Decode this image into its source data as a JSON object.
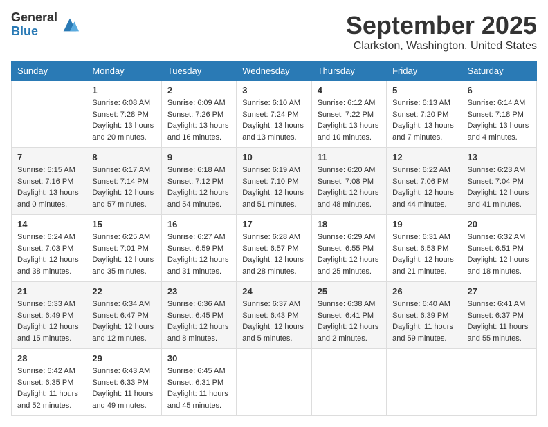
{
  "logo": {
    "general": "General",
    "blue": "Blue"
  },
  "header": {
    "month": "September 2025",
    "location": "Clarkston, Washington, United States"
  },
  "weekdays": [
    "Sunday",
    "Monday",
    "Tuesday",
    "Wednesday",
    "Thursday",
    "Friday",
    "Saturday"
  ],
  "weeks": [
    [
      {
        "day": "",
        "info": ""
      },
      {
        "day": "1",
        "info": "Sunrise: 6:08 AM\nSunset: 7:28 PM\nDaylight: 13 hours\nand 20 minutes."
      },
      {
        "day": "2",
        "info": "Sunrise: 6:09 AM\nSunset: 7:26 PM\nDaylight: 13 hours\nand 16 minutes."
      },
      {
        "day": "3",
        "info": "Sunrise: 6:10 AM\nSunset: 7:24 PM\nDaylight: 13 hours\nand 13 minutes."
      },
      {
        "day": "4",
        "info": "Sunrise: 6:12 AM\nSunset: 7:22 PM\nDaylight: 13 hours\nand 10 minutes."
      },
      {
        "day": "5",
        "info": "Sunrise: 6:13 AM\nSunset: 7:20 PM\nDaylight: 13 hours\nand 7 minutes."
      },
      {
        "day": "6",
        "info": "Sunrise: 6:14 AM\nSunset: 7:18 PM\nDaylight: 13 hours\nand 4 minutes."
      }
    ],
    [
      {
        "day": "7",
        "info": "Sunrise: 6:15 AM\nSunset: 7:16 PM\nDaylight: 13 hours\nand 0 minutes."
      },
      {
        "day": "8",
        "info": "Sunrise: 6:17 AM\nSunset: 7:14 PM\nDaylight: 12 hours\nand 57 minutes."
      },
      {
        "day": "9",
        "info": "Sunrise: 6:18 AM\nSunset: 7:12 PM\nDaylight: 12 hours\nand 54 minutes."
      },
      {
        "day": "10",
        "info": "Sunrise: 6:19 AM\nSunset: 7:10 PM\nDaylight: 12 hours\nand 51 minutes."
      },
      {
        "day": "11",
        "info": "Sunrise: 6:20 AM\nSunset: 7:08 PM\nDaylight: 12 hours\nand 48 minutes."
      },
      {
        "day": "12",
        "info": "Sunrise: 6:22 AM\nSunset: 7:06 PM\nDaylight: 12 hours\nand 44 minutes."
      },
      {
        "day": "13",
        "info": "Sunrise: 6:23 AM\nSunset: 7:04 PM\nDaylight: 12 hours\nand 41 minutes."
      }
    ],
    [
      {
        "day": "14",
        "info": "Sunrise: 6:24 AM\nSunset: 7:03 PM\nDaylight: 12 hours\nand 38 minutes."
      },
      {
        "day": "15",
        "info": "Sunrise: 6:25 AM\nSunset: 7:01 PM\nDaylight: 12 hours\nand 35 minutes."
      },
      {
        "day": "16",
        "info": "Sunrise: 6:27 AM\nSunset: 6:59 PM\nDaylight: 12 hours\nand 31 minutes."
      },
      {
        "day": "17",
        "info": "Sunrise: 6:28 AM\nSunset: 6:57 PM\nDaylight: 12 hours\nand 28 minutes."
      },
      {
        "day": "18",
        "info": "Sunrise: 6:29 AM\nSunset: 6:55 PM\nDaylight: 12 hours\nand 25 minutes."
      },
      {
        "day": "19",
        "info": "Sunrise: 6:31 AM\nSunset: 6:53 PM\nDaylight: 12 hours\nand 21 minutes."
      },
      {
        "day": "20",
        "info": "Sunrise: 6:32 AM\nSunset: 6:51 PM\nDaylight: 12 hours\nand 18 minutes."
      }
    ],
    [
      {
        "day": "21",
        "info": "Sunrise: 6:33 AM\nSunset: 6:49 PM\nDaylight: 12 hours\nand 15 minutes."
      },
      {
        "day": "22",
        "info": "Sunrise: 6:34 AM\nSunset: 6:47 PM\nDaylight: 12 hours\nand 12 minutes."
      },
      {
        "day": "23",
        "info": "Sunrise: 6:36 AM\nSunset: 6:45 PM\nDaylight: 12 hours\nand 8 minutes."
      },
      {
        "day": "24",
        "info": "Sunrise: 6:37 AM\nSunset: 6:43 PM\nDaylight: 12 hours\nand 5 minutes."
      },
      {
        "day": "25",
        "info": "Sunrise: 6:38 AM\nSunset: 6:41 PM\nDaylight: 12 hours\nand 2 minutes."
      },
      {
        "day": "26",
        "info": "Sunrise: 6:40 AM\nSunset: 6:39 PM\nDaylight: 11 hours\nand 59 minutes."
      },
      {
        "day": "27",
        "info": "Sunrise: 6:41 AM\nSunset: 6:37 PM\nDaylight: 11 hours\nand 55 minutes."
      }
    ],
    [
      {
        "day": "28",
        "info": "Sunrise: 6:42 AM\nSunset: 6:35 PM\nDaylight: 11 hours\nand 52 minutes."
      },
      {
        "day": "29",
        "info": "Sunrise: 6:43 AM\nSunset: 6:33 PM\nDaylight: 11 hours\nand 49 minutes."
      },
      {
        "day": "30",
        "info": "Sunrise: 6:45 AM\nSunset: 6:31 PM\nDaylight: 11 hours\nand 45 minutes."
      },
      {
        "day": "",
        "info": ""
      },
      {
        "day": "",
        "info": ""
      },
      {
        "day": "",
        "info": ""
      },
      {
        "day": "",
        "info": ""
      }
    ]
  ]
}
